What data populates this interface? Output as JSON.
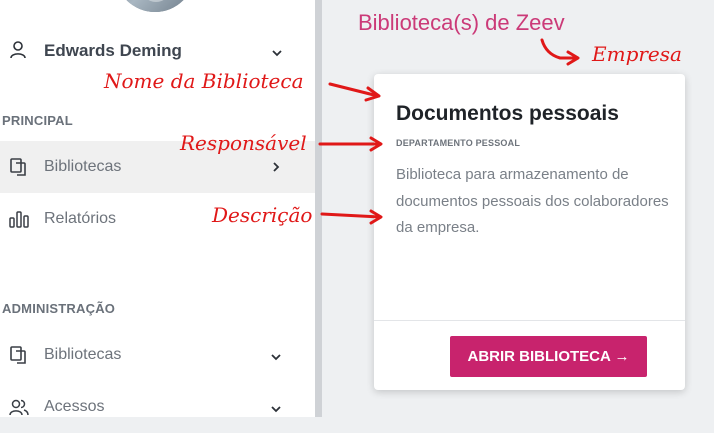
{
  "sidebar": {
    "user": {
      "name": "Edwards Deming"
    },
    "sections": [
      {
        "label": "PRINCIPAL"
      },
      {
        "label": "ADMINISTRAÇÃO"
      }
    ],
    "principal_items": [
      {
        "label": "Bibliotecas",
        "icon": "copy-icon",
        "indicator": "chevron-right"
      },
      {
        "label": "Relatórios",
        "icon": "bar-chart-icon"
      }
    ],
    "admin_items": [
      {
        "label": "Bibliotecas",
        "icon": "copy-icon",
        "indicator": "chevron-down"
      },
      {
        "label": "Acessos",
        "icon": "users-icon",
        "indicator": "chevron-down"
      }
    ]
  },
  "main": {
    "title": "Biblioteca(s) de Zeev",
    "card": {
      "name": "Documentos pessoais",
      "department": "DEPARTAMENTO PESSOAL",
      "description": "Biblioteca para armazenamento de documentos pessoais dos colaboradores da empresa.",
      "button_label": "ABRIR BIBLIOTECA →"
    }
  },
  "annotations": {
    "empresa": "Empresa",
    "nome": "Nome da Biblioteca",
    "responsavel": "Responsável",
    "descricao": "Descrição"
  },
  "colors": {
    "accent": "#c8236d",
    "title": "#cb3a78",
    "annotation": "#e01818"
  }
}
